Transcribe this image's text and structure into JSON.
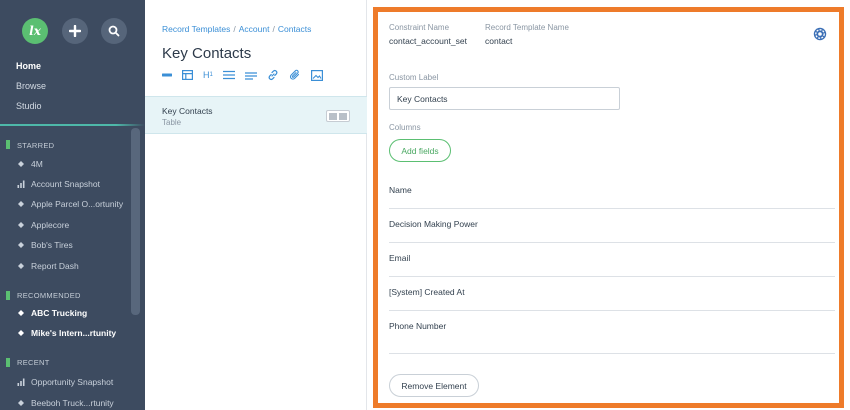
{
  "sidebar": {
    "logo_text": "lx",
    "nav": [
      {
        "label": "Home"
      },
      {
        "label": "Browse"
      },
      {
        "label": "Studio"
      }
    ],
    "sections": {
      "starred": {
        "heading": "STARRED",
        "items": [
          "4M",
          "Account Snapshot",
          "Apple Parcel O...ortunity",
          "Applecore",
          "Bob's Tires",
          "Report Dash"
        ]
      },
      "recommended": {
        "heading": "RECOMMENDED",
        "items": [
          "ABC Trucking",
          "Mike's Intern...rtunity"
        ]
      },
      "recent": {
        "heading": "RECENT",
        "items": [
          "Opportunity Snapshot",
          "Beeboh Truck...rtunity"
        ]
      }
    },
    "accent_color": "#5bbf72"
  },
  "middle": {
    "breadcrumb": [
      "Record Templates",
      "Account",
      "Contacts"
    ],
    "breadcrumb_sep": "/",
    "title": "Key Contacts",
    "toolbar_icons": [
      "minus-icon",
      "table-icon",
      "h1-icon",
      "list-icon",
      "lines-icon",
      "link-icon",
      "attachment-icon",
      "image-icon"
    ],
    "toolbar_h1": "H",
    "toolbar_h1_sub": "1",
    "selected_row": {
      "title": "Key Contacts",
      "subtitle": "Table"
    }
  },
  "detail": {
    "constraint_name_label": "Constraint Name",
    "constraint_name_value": "contact_account_set",
    "record_template_label": "Record Template Name",
    "record_template_value": "contact",
    "custom_label_label": "Custom Label",
    "custom_label_value": "Key Contacts",
    "columns_label": "Columns",
    "add_fields_label": "Add fields",
    "fields": [
      "Name",
      "Decision Making Power",
      "Email",
      "[System] Created At",
      "Phone Number"
    ],
    "remove_label": "Remove Element",
    "highlight_color": "#ee7b2a"
  }
}
